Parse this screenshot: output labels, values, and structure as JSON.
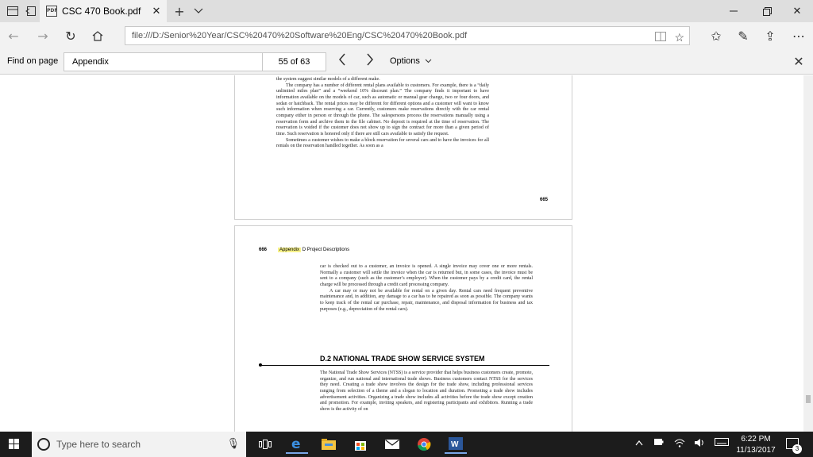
{
  "browser": {
    "tab_title": "CSC 470 Book.pdf",
    "url": "file:///D:/Senior%20Year/CSC%20470%20Software%20Eng/CSC%20470%20Book.pdf"
  },
  "findbar": {
    "label": "Find on page",
    "query": "Appendix",
    "count": "55 of 63",
    "options_label": "Options"
  },
  "page665": {
    "paragraphs": [
      "the system suggest similar models of a different make.",
      "The company has a number of different rental plans available to customers. For example, there is a “daily unlimited miles plan” and a “weekend 10% discount plan.” The company finds it important to have information available on the models of car, such as automatic or manual gear change, two or four doors, and sedan or hatchback. The rental prices may be different for different options and a customer will want to know such information when reserving a car. Currently, customers make reservations directly with the car rental company either in person or through the phone. The salespersons process the reservations manually using a reservation form and archive them in the file cabinet. No deposit is required at the time of reservation. The reservation is voided if the customer does not show up to sign the contract for more than a given period of time. Such reservation is honored only if there are still cars available to satisfy the request.",
      "Sometimes a customer wishes to make a block reservation for several cars and to have the invoices for all rentals on the reservation handled together. As soon as a"
    ],
    "page_number": "665"
  },
  "page666": {
    "page_number": "666",
    "running_head_highlight": "Appendix",
    "running_head_rest": " D   Project Descriptions",
    "paragraphs": [
      "car is checked out to a customer, an invoice is opened. A single invoice may cover one or more rentals. Normally a customer will settle the invoice when the car is returned but, in some cases, the invoice must be sent to a company (such as the customer’s employer). When the customer pays by a credit card, the rental charge will be processed through a credit card processing company.",
      "A car may or may not be available for rental on a given day. Rental cars need frequent preventive maintenance and, in addition, any damage to a car has to be repaired as soon as possible. The company wants to keep track of the rental car purchase, repair, maintenance, and disposal information for business and tax purposes (e.g., depreciation of the rental cars)."
    ],
    "section_heading": "D.2  NATIONAL TRADE SHOW SERVICE SYSTEM",
    "section_paragraph": "The National Trade Show Services (NTSS) is a service provider that helps business customers create, promote, organize, and run national and international trade shows. Business customers contact NTSS for the services they need. Creating a trade show involves the design for the trade show, including professional services ranging from selection of a theme and a slogan to location and duration. Promoting a trade show includes advertisement activities. Organizing a trade show includes all activities before the trade show except creation and promotion. For example, inviting speakers, and registering participants and exhibitors. Running a trade show is the activity of on"
  },
  "taskbar": {
    "search_placeholder": "Type here to search",
    "time": "6:22 PM",
    "date": "11/13/2017",
    "notification_count": "3"
  }
}
